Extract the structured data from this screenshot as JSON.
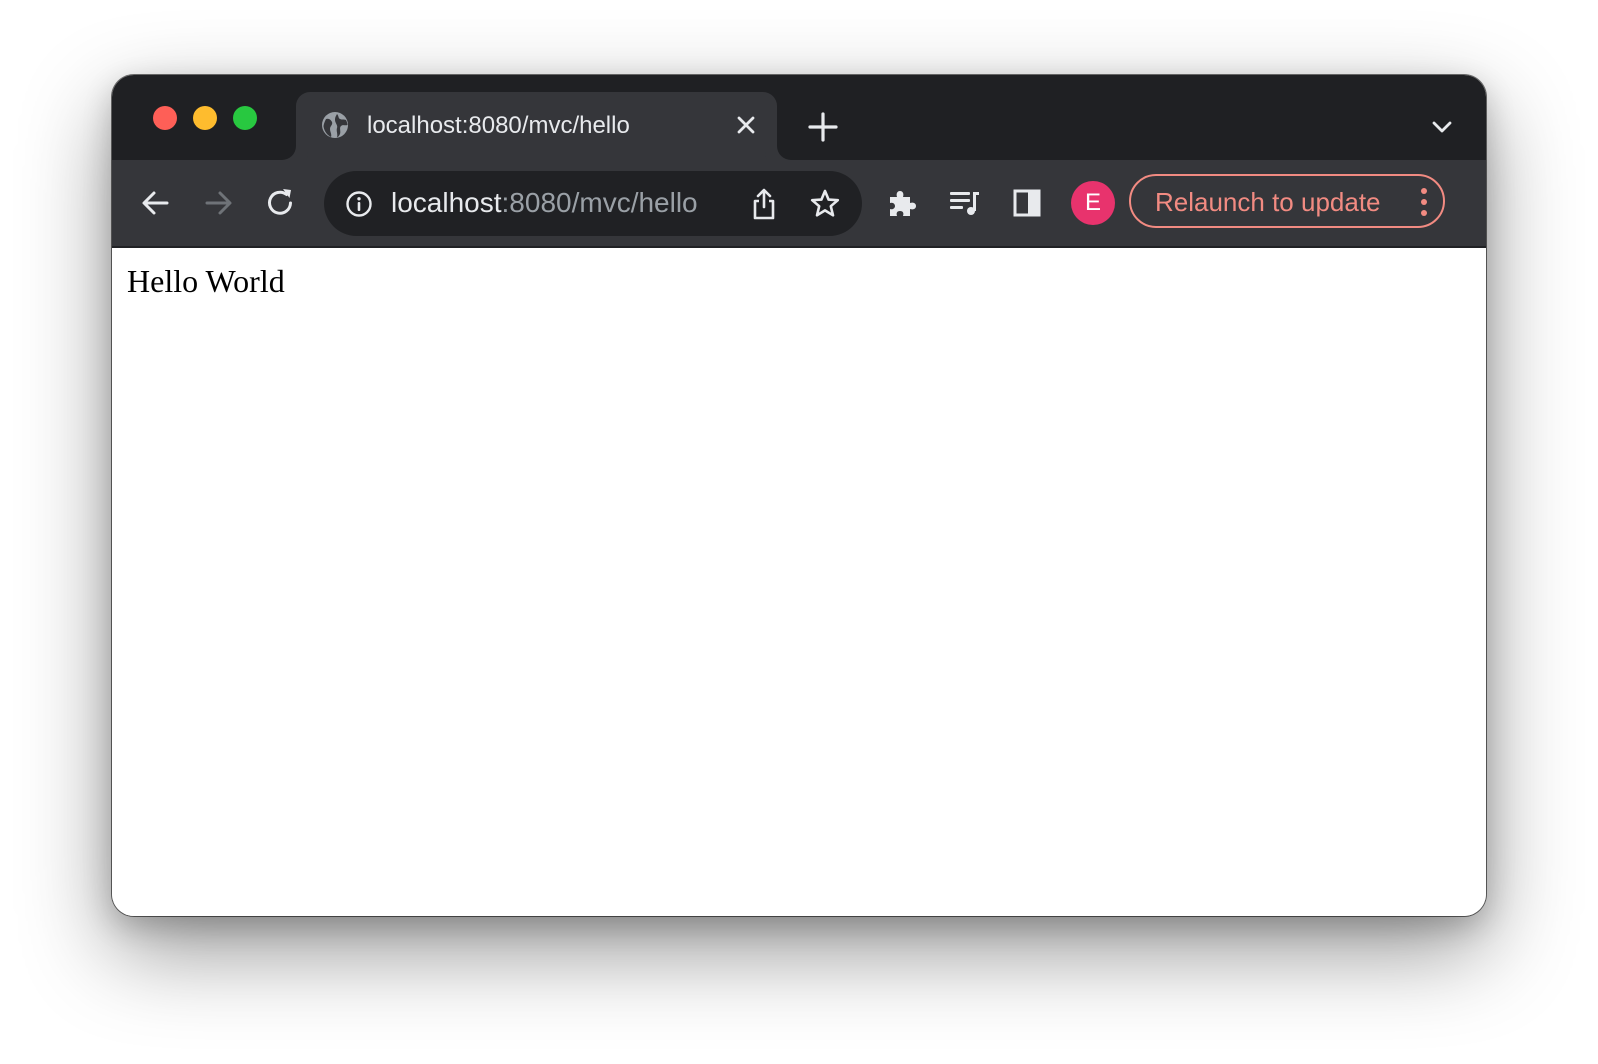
{
  "tab": {
    "title": "localhost:8080/mvc/hello",
    "favicon": "globe-icon"
  },
  "omnibox": {
    "host": "localhost",
    "rest": ":8080/mvc/hello"
  },
  "profile": {
    "initial": "E",
    "color": "#e8336d"
  },
  "relaunch": {
    "label": "Relaunch to update",
    "color": "#f28b82"
  },
  "page": {
    "text": "Hello World"
  }
}
